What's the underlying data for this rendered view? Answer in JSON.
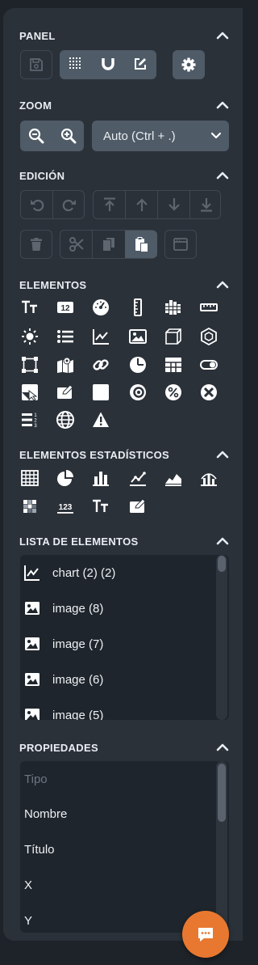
{
  "panel": {
    "title": "PANEL"
  },
  "zoom": {
    "title": "ZOOM",
    "select_value": "Auto (Ctrl + .)"
  },
  "edition": {
    "title": "EDICIÓN"
  },
  "elements": {
    "title": "ELEMENTOS"
  },
  "stat_elements": {
    "title": "ELEMENTOS ESTADÍSTICOS"
  },
  "element_list": {
    "title": "LISTA DE ELEMENTOS",
    "items": [
      {
        "label": "chart (2) (2)",
        "icon": "line-chart-icon"
      },
      {
        "label": "image (8)",
        "icon": "image-icon"
      },
      {
        "label": "image (7)",
        "icon": "image-icon"
      },
      {
        "label": "image (6)",
        "icon": "image-icon"
      },
      {
        "label": "image (5)",
        "icon": "image-icon"
      }
    ]
  },
  "properties": {
    "title": "PROPIEDADES",
    "items": [
      {
        "label": "Tipo",
        "muted": true
      },
      {
        "label": "Nombre"
      },
      {
        "label": "Título"
      },
      {
        "label": "X"
      },
      {
        "label": "Y"
      }
    ]
  },
  "colors": {
    "accent": "#e8782f",
    "panel": "#2b3139",
    "button": "#4f5b67"
  }
}
